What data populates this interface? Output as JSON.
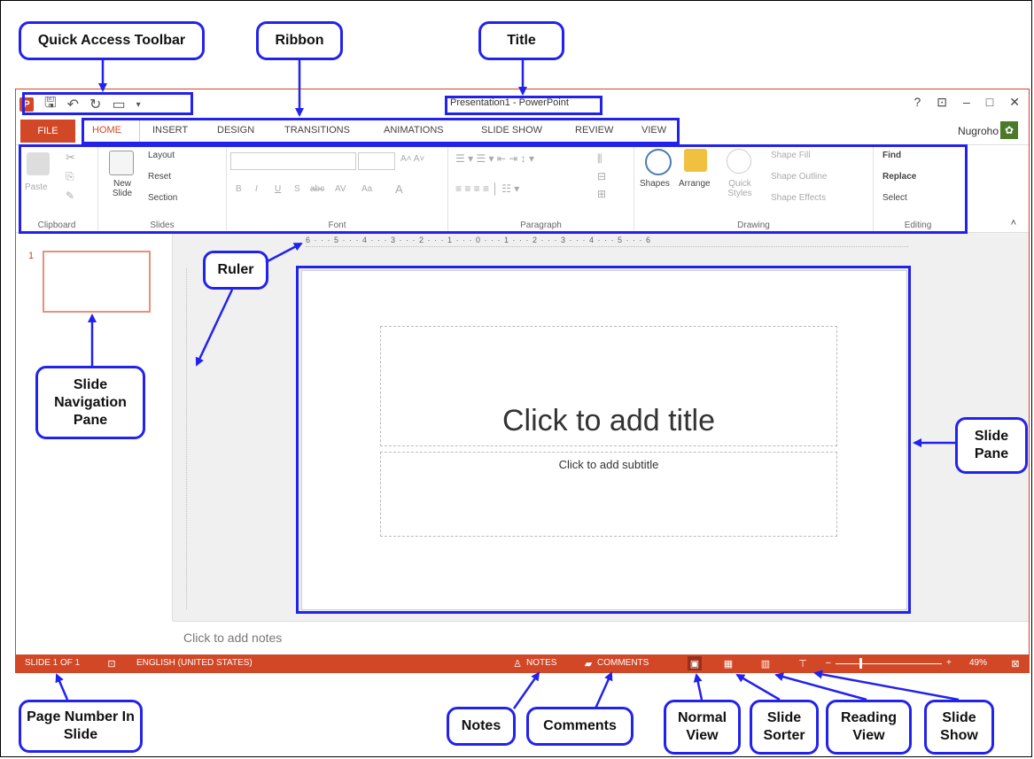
{
  "callouts": {
    "quick_access_toolbar": "Quick Access Toolbar",
    "ribbon": "Ribbon",
    "title": "Title",
    "ruler": "Ruler",
    "slide_navigation_pane": "Slide Navigation Pane",
    "slide_pane": "Slide Pane",
    "page_number": "Page Number In Slide",
    "notes": "Notes",
    "comments": "Comments",
    "normal_view": "Normal View",
    "slide_sorter": "Slide Sorter",
    "reading_view": "Reading View",
    "slide_show": "Slide Show"
  },
  "window": {
    "title": "Presentation1 - PowerPoint",
    "controls": [
      "?",
      "⊡",
      "–",
      "□",
      "✕"
    ],
    "user": "Nugroho",
    "accent": "#d24726"
  },
  "tabs": {
    "file": "FILE",
    "items": [
      "HOME",
      "INSERT",
      "DESIGN",
      "TRANSITIONS",
      "ANIMATIONS",
      "SLIDE SHOW",
      "REVIEW",
      "VIEW"
    ]
  },
  "ribbon": {
    "clipboard": {
      "label": "Clipboard",
      "paste": "Paste"
    },
    "slides": {
      "label": "Slides",
      "new_slide": "New Slide",
      "layout": "Layout",
      "reset": "Reset",
      "section": "Section"
    },
    "font": {
      "label": "Font",
      "buttons": [
        "B",
        "I",
        "U",
        "S",
        "abc",
        "AV",
        "Aa",
        "A"
      ]
    },
    "paragraph": {
      "label": "Paragraph"
    },
    "drawing": {
      "label": "Drawing",
      "shapes": "Shapes",
      "arrange": "Arrange",
      "quick_styles": "Quick Styles",
      "shape_fill": "Shape Fill",
      "shape_outline": "Shape Outline",
      "shape_effects": "Shape Effects"
    },
    "editing": {
      "label": "Editing",
      "find": "Find",
      "replace": "Replace",
      "select": "Select"
    }
  },
  "nav": {
    "slide_number": "1"
  },
  "ruler": {
    "h_ticks": "6 · · · 5 · · · 4 · · · 3 · · · 2 · · · 1 · · · 0 · · · 1 · · · 2 · · · 3 · · · 4 · · · 5 · · · 6"
  },
  "slide": {
    "title_placeholder": "Click to add title",
    "subtitle_placeholder": "Click to add subtitle"
  },
  "notes_placeholder": "Click to add notes",
  "status": {
    "slide_of": "SLIDE 1 OF 1",
    "language": "ENGLISH (UNITED STATES)",
    "notes": "NOTES",
    "comments": "COMMENTS",
    "zoom": "49%"
  }
}
